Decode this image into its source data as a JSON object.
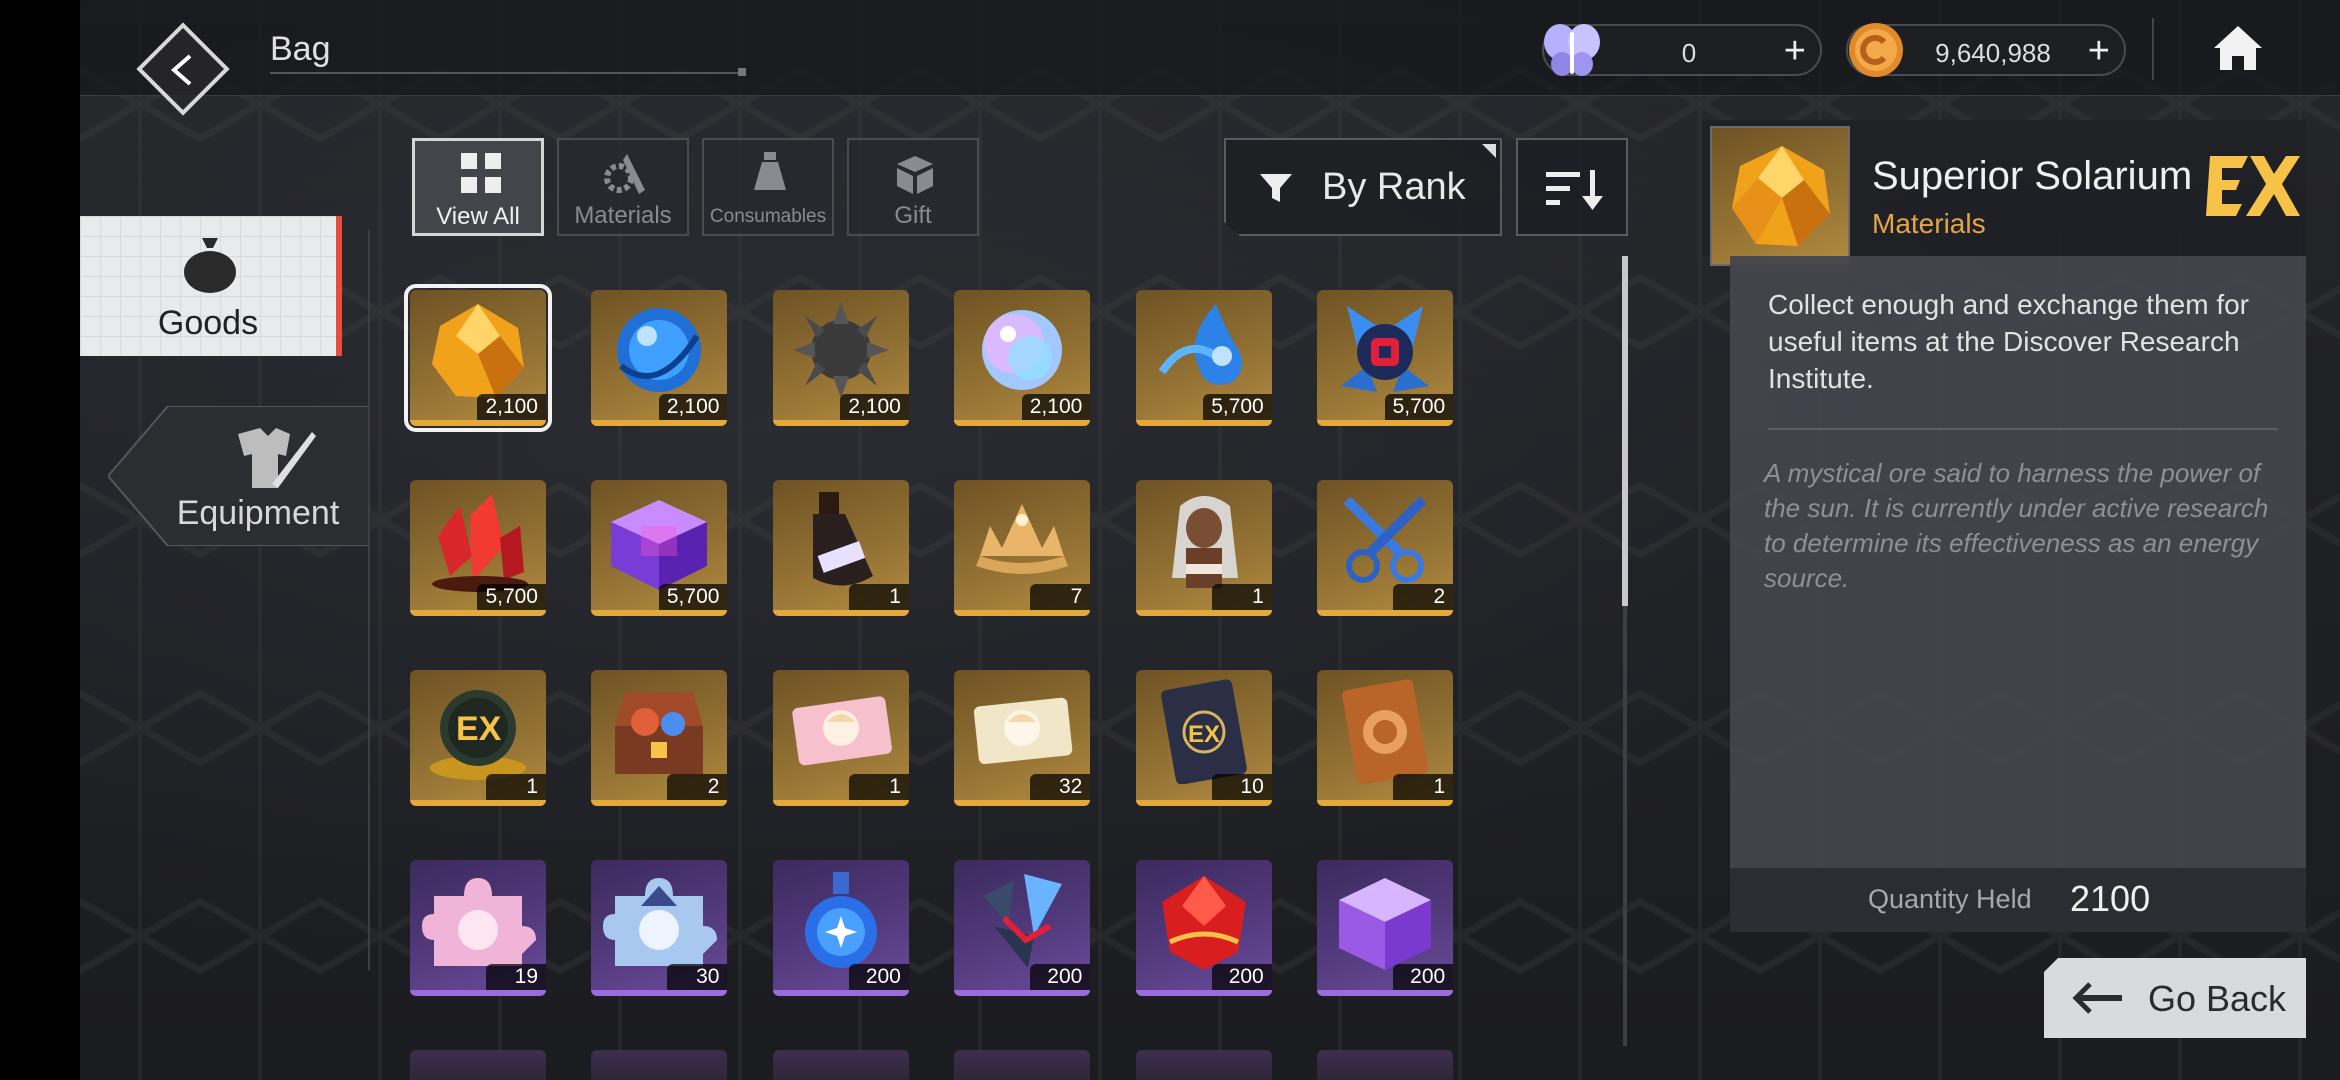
{
  "header": {
    "title": "Bag",
    "currencies": [
      {
        "icon": "butterfly-icon",
        "value": "0"
      },
      {
        "icon": "gold-coin-icon",
        "value": "9,640,988"
      }
    ]
  },
  "sidebar": {
    "tabs": [
      {
        "label": "Goods",
        "icon": "money-bag-icon",
        "active": true
      },
      {
        "label": "Equipment",
        "icon": "armor-sword-icon",
        "active": false
      }
    ]
  },
  "filters": {
    "tabs": [
      {
        "label": "View All",
        "active": true
      },
      {
        "label": "Materials",
        "active": false
      },
      {
        "label": "Consumables",
        "active": false
      },
      {
        "label": "Gift",
        "active": false
      }
    ],
    "sort_label": "By Rank"
  },
  "items": [
    {
      "qty": "2,100",
      "rarity": "gold",
      "art": "amber-gem",
      "selected": true
    },
    {
      "qty": "2,100",
      "rarity": "gold",
      "art": "blue-crystal-sphere"
    },
    {
      "qty": "2,100",
      "rarity": "gold",
      "art": "spiked-dark-orb"
    },
    {
      "qty": "2,100",
      "rarity": "gold",
      "art": "iridescent-orb"
    },
    {
      "qty": "5,700",
      "rarity": "gold",
      "art": "blue-droplet-swirl"
    },
    {
      "qty": "5,700",
      "rarity": "gold",
      "art": "blue-crystal-core"
    },
    {
      "qty": "5,700",
      "rarity": "gold",
      "art": "red-crystal-cluster"
    },
    {
      "qty": "5,700",
      "rarity": "gold",
      "art": "purple-cube"
    },
    {
      "qty": "1",
      "rarity": "gold",
      "art": "potion-bottle"
    },
    {
      "qty": "7",
      "rarity": "gold",
      "art": "golden-tiara"
    },
    {
      "qty": "1",
      "rarity": "gold",
      "art": "elf-character"
    },
    {
      "qty": "2",
      "rarity": "gold",
      "art": "blue-scissors"
    },
    {
      "qty": "1",
      "rarity": "gold",
      "art": "ex-orb"
    },
    {
      "qty": "2",
      "rarity": "gold",
      "art": "treasure-chest"
    },
    {
      "qty": "1",
      "rarity": "gold",
      "art": "pink-ticket"
    },
    {
      "qty": "32",
      "rarity": "gold",
      "art": "cream-ticket"
    },
    {
      "qty": "10",
      "rarity": "gold",
      "art": "ex-card"
    },
    {
      "qty": "1",
      "rarity": "gold",
      "art": "bronze-card"
    },
    {
      "qty": "19",
      "rarity": "purple",
      "art": "pink-puzzle-piece"
    },
    {
      "qty": "30",
      "rarity": "purple",
      "art": "blue-puzzle-piece"
    },
    {
      "qty": "200",
      "rarity": "purple",
      "art": "blue-flask"
    },
    {
      "qty": "200",
      "rarity": "purple",
      "art": "blue-shard"
    },
    {
      "qty": "200",
      "rarity": "purple",
      "art": "red-gem"
    },
    {
      "qty": "200",
      "rarity": "purple",
      "art": "violet-cube"
    }
  ],
  "detail": {
    "name": "Superior Solarium",
    "type": "Materials",
    "badge": "EX",
    "description": "Collect enough and exchange them for useful items at the Discover Research Institute.",
    "lore": "A mystical ore said to harness the power of the sun. It is currently under active research to determine its effectiveness as an energy source.",
    "quantity_label": "Quantity Held",
    "quantity_value": "2100"
  },
  "go_back_label": "Go Back",
  "colors": {
    "accent_red": "#e74c3c",
    "gold_border": "#e3a93a",
    "purple_border": "#9b6ddc",
    "materials_text": "#e3a54a"
  }
}
